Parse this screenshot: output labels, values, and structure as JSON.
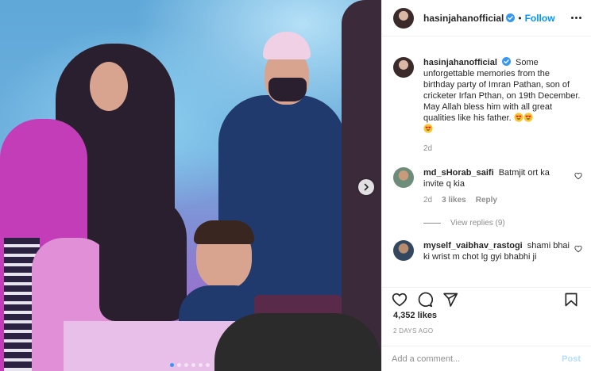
{
  "post": {
    "username": "hasinjahanofficial",
    "follow_label": "Follow",
    "separator": "•",
    "caption": {
      "text": "Some unforgettable memories from the birthday party of Imran Pathan, son of cricketer Irfan Pthan, on 19th December. May Allah bless him with all great qualities like his father.",
      "time": "2d"
    },
    "comments": [
      {
        "username": "md_sHorab_saifi",
        "text": "Batmjit ort ka invite q kia",
        "time": "2d",
        "likes": "3 likes",
        "reply_label": "Reply",
        "view_replies": "View replies (9)"
      },
      {
        "username": "myself_vaibhav_rastogi",
        "text": "shami bhai ki wrist m chot lg gyi bhabhi ji"
      }
    ],
    "likes_count": "4,352 likes",
    "time_ago": "2 DAYS AGO",
    "add_comment_placeholder": "Add a comment...",
    "post_button": "Post"
  },
  "carousel": {
    "total_slides": 6,
    "active_slide": 1
  },
  "colors": {
    "accent": "#0095f6",
    "verified": "#3897f0",
    "muted": "#8e8e8e"
  }
}
